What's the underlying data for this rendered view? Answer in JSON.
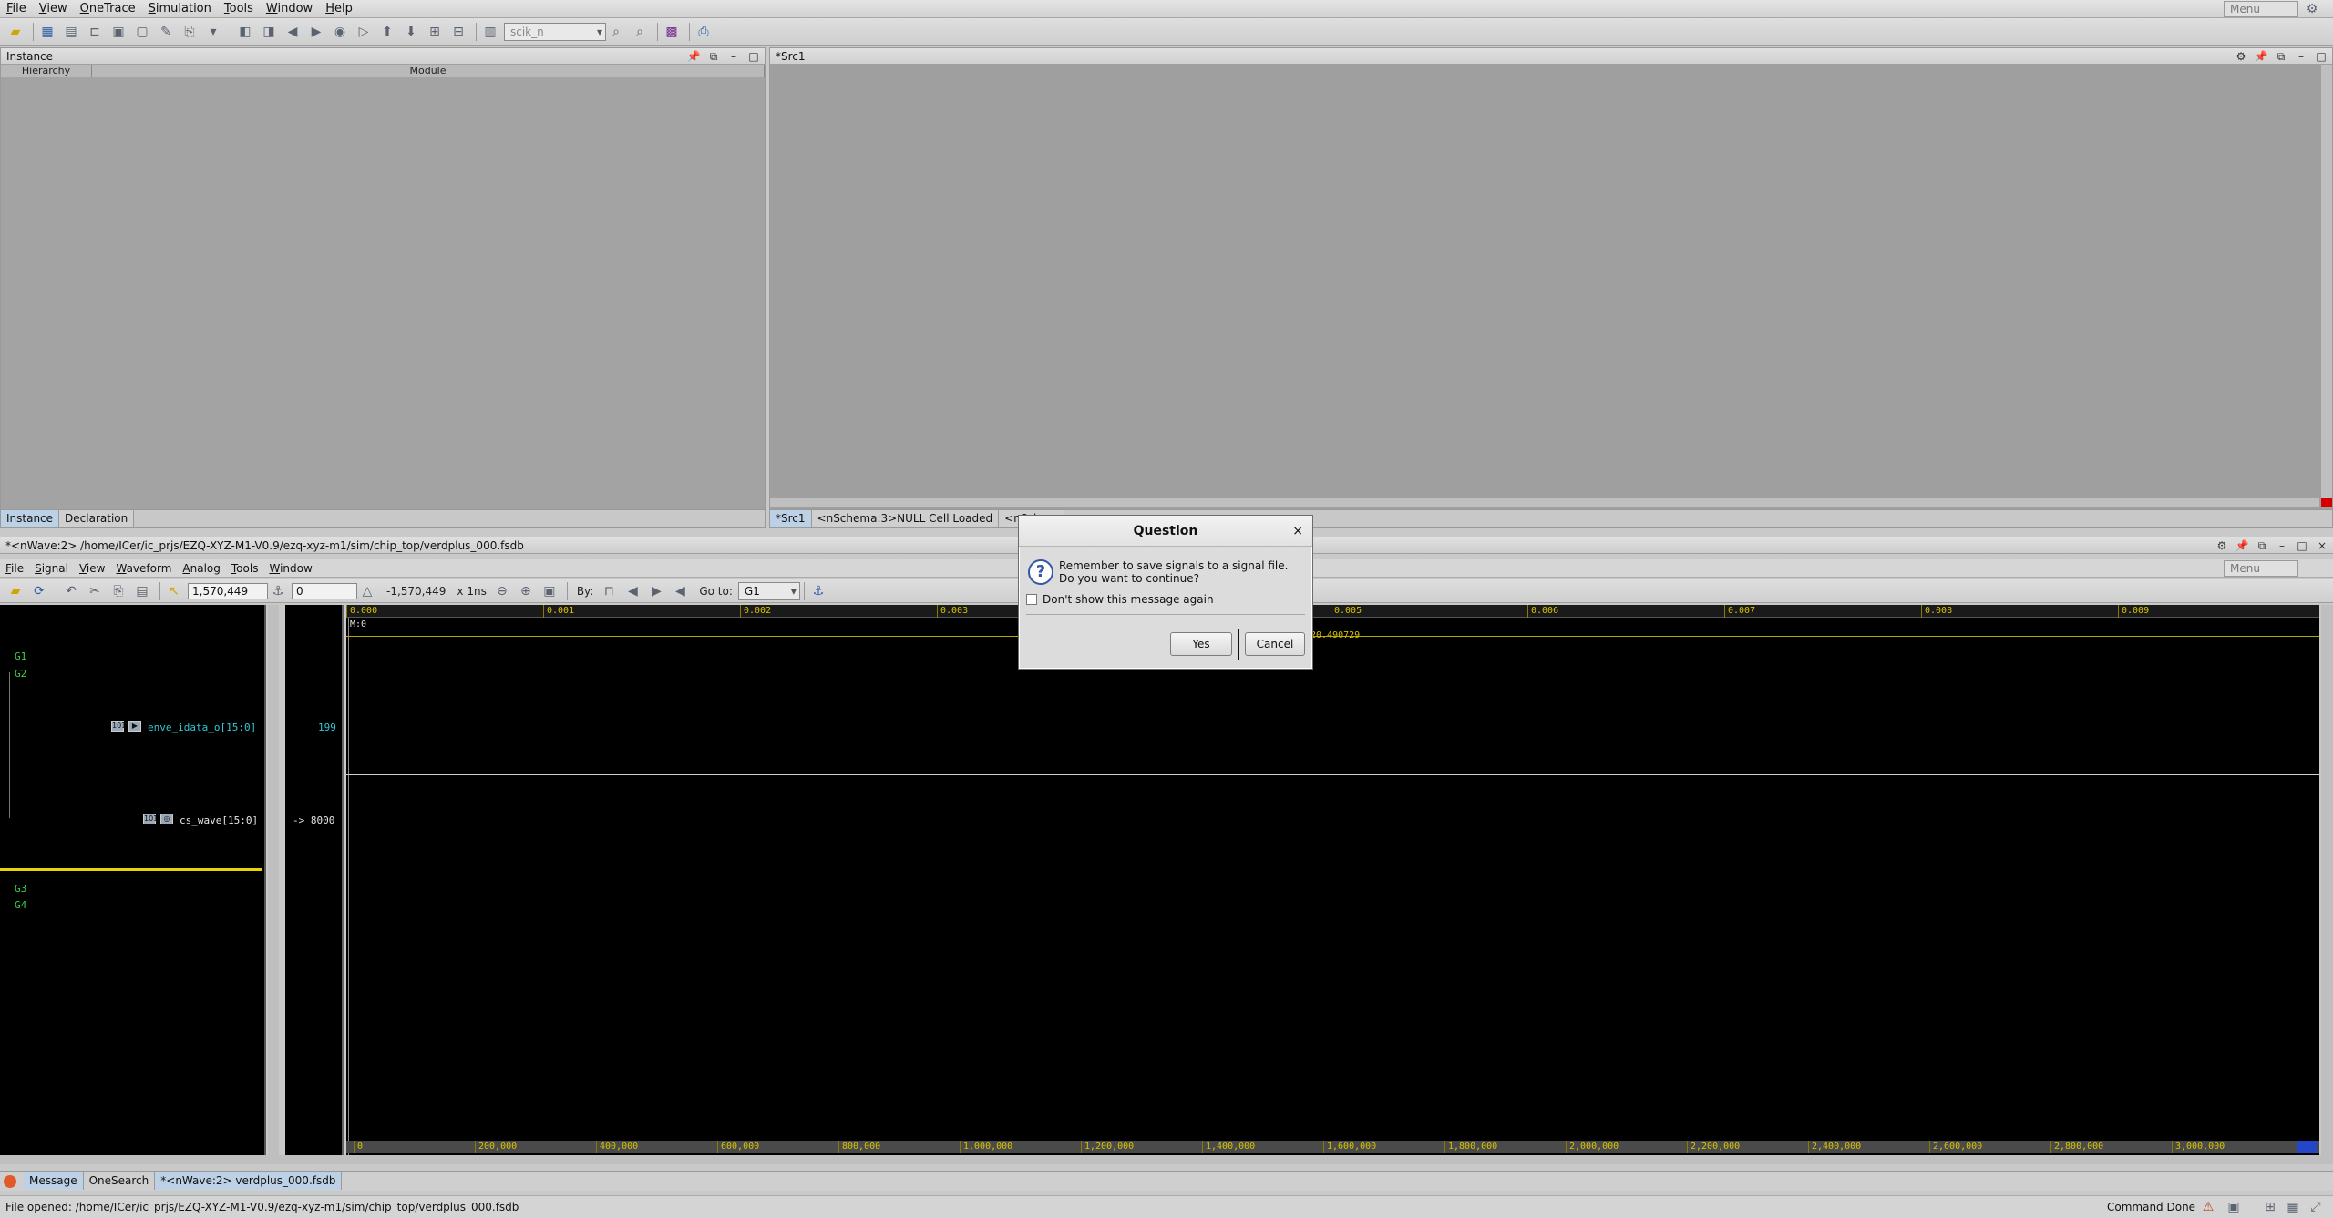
{
  "menubar": {
    "items": [
      "File",
      "View",
      "OneTrace",
      "Simulation",
      "Tools",
      "Window",
      "Help"
    ],
    "menu_combo": "Menu"
  },
  "toolbar": {
    "signal_combo": "scik_n"
  },
  "instance_pane": {
    "title": "Instance",
    "columns": [
      "Hierarchy",
      "Module"
    ],
    "tabs": [
      "Instance",
      "Declaration"
    ]
  },
  "src_pane": {
    "title": "*Src1",
    "tabs": [
      "*Src1",
      "<nSchema:3>NULL Cell Loaded",
      "<nSchem"
    ]
  },
  "nwave": {
    "title": "*<nWave:2> /home/ICer/ic_prjs/EZQ-XYZ-M1-V0.9/ezq-xyz-m1/sim/chip_top/verdplus_000.fsdb",
    "menu": [
      "File",
      "Signal",
      "View",
      "Waveform",
      "Analog",
      "Tools",
      "Window"
    ],
    "menu_combo": "Menu",
    "cursor": "1,570,449",
    "marker": "0",
    "delta": "-1,570,449",
    "timescale": "x 1ns",
    "by_label": "By:",
    "goto_label": "Go to:",
    "goto_value": "G1",
    "groups": [
      "G1",
      "G2",
      "G3",
      "G4"
    ],
    "signals": [
      {
        "name": "enve_idata_o[15:0]",
        "value": "199"
      },
      {
        "name": "cs_wave[15:0]",
        "value": "-> 8000"
      }
    ],
    "marker_label": "M:0",
    "cursor_readout": "20.490729",
    "top_ruler": [
      "0.000",
      "0.001",
      "0.002",
      "0.003",
      "0.005",
      "0.006",
      "0.007",
      "0.008",
      "0.009"
    ],
    "bottom_ruler": [
      "0",
      "200,000",
      "400,000",
      "600,000",
      "800,000",
      "1,000,000",
      "1,200,000",
      "1,400,000",
      "1,600,000",
      "1,800,000",
      "2,000,000",
      "2,200,000",
      "2,400,000",
      "2,600,000",
      "2,800,000",
      "3,000,000"
    ]
  },
  "taskbar": {
    "tabs": [
      "Message",
      "OneSearch",
      "*<nWave:2> verdplus_000.fsdb"
    ]
  },
  "status": {
    "text": "File opened: /home/ICer/ic_prjs/EZQ-XYZ-M1-V0.9/ezq-xyz-m1/sim/chip_top/verdplus_000.fsdb",
    "right": "Command Done"
  },
  "dialog": {
    "title": "Question",
    "close": "×",
    "line1": "Remember to save signals to a signal file.",
    "line2": "Do you want to continue?",
    "checkbox": "Don't show this message again",
    "yes": "Yes",
    "cancel": "Cancel"
  },
  "colors": {
    "wave_bg": "#000000",
    "group": "#38d44a",
    "signal": "#35c6d6",
    "ruler": "#d8c200",
    "dialog_icon": "#3656a8"
  }
}
